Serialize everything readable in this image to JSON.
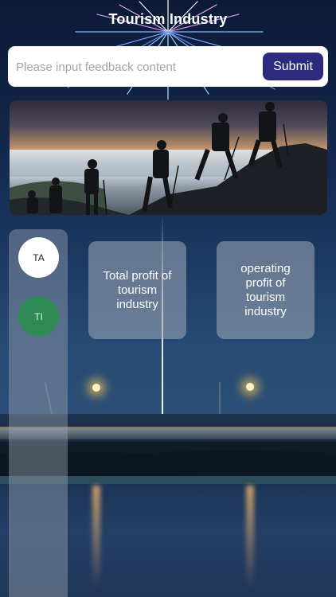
{
  "header": {
    "title": "Tourism Industry"
  },
  "feedback": {
    "placeholder": "Please input feedback content",
    "value": "",
    "submit_label": "Submit"
  },
  "banner": {
    "alt": "Hikers silhouetted on a mountain ridge above a sea of clouds at sunrise"
  },
  "sidebar": {
    "items": [
      {
        "label": "TA",
        "selected": true,
        "color": "#ffffff"
      },
      {
        "label": "TI",
        "selected": false,
        "color": "#2f8a56"
      }
    ]
  },
  "cards": [
    {
      "label": "Total profit of tourism industry"
    },
    {
      "label": "operating profit of tourism industry"
    }
  ],
  "colors": {
    "accent": "#2c2a7e",
    "tab_active": "#ffffff",
    "tab_inactive": "#2f8a56"
  }
}
